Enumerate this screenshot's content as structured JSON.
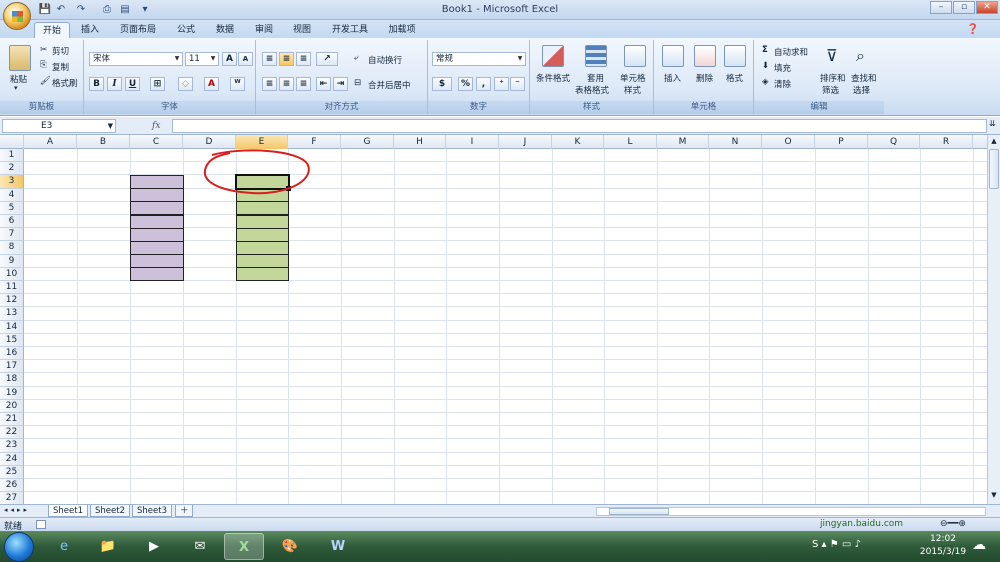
{
  "window": {
    "title": "Book1 - Microsoft Excel",
    "minimize": "–",
    "maximize": "▫",
    "close": "✕"
  },
  "qat": {
    "save": "💾",
    "undo": "↶",
    "redo": "↷",
    "print": "⎙",
    "more": "▾"
  },
  "tabs": [
    "开始",
    "插入",
    "页面布局",
    "公式",
    "数据",
    "审阅",
    "视图",
    "开发工具",
    "加载项"
  ],
  "ribbon": {
    "clipboard": {
      "label": "剪贴板",
      "paste": "粘贴",
      "cut": "剪切",
      "copy": "复制",
      "format_painter": "格式刷"
    },
    "font": {
      "label": "字体",
      "name": "宋体",
      "size": "11",
      "grow": "A",
      "shrink": "A",
      "bold": "B",
      "italic": "I",
      "underline": "U",
      "fill_glyph": "◇",
      "fontcolor_glyph": "A",
      "phonetic_glyph": "ᵂ"
    },
    "alignment": {
      "label": "对齐方式",
      "wrap": "自动换行",
      "merge": "合并后居中"
    },
    "number": {
      "label": "数字",
      "format": "常规",
      "percent": "%",
      "comma": ","
    },
    "styles": {
      "label": "样式",
      "conditional": "条件格式",
      "table_fmt_1": "套用",
      "table_fmt_2": "表格格式",
      "cell_style_1": "单元格",
      "cell_style_2": "样式"
    },
    "cells": {
      "label": "单元格",
      "insert": "插入",
      "delete": "删除",
      "format": "格式"
    },
    "editing": {
      "label": "编辑",
      "autosum": "自动求和",
      "fill": "填充",
      "clear": "清除",
      "sort_1": "排序和",
      "sort_2": "筛选",
      "find_1": "查找和",
      "find_2": "选择"
    }
  },
  "formula_bar": {
    "name_box": "E3",
    "fx": "fx",
    "value": ""
  },
  "columns": [
    "A",
    "B",
    "C",
    "D",
    "E",
    "F",
    "G",
    "H",
    "I",
    "J",
    "K",
    "L",
    "M",
    "N",
    "O",
    "P",
    "Q",
    "R"
  ],
  "rows": [
    "1",
    "2",
    "3",
    "4",
    "5",
    "6",
    "7",
    "8",
    "9",
    "10",
    "11",
    "12",
    "13",
    "14",
    "15",
    "16",
    "17",
    "18",
    "19",
    "20",
    "21",
    "22",
    "23",
    "24",
    "25",
    "26",
    "27"
  ],
  "selected_cell": "E3",
  "sheets": [
    "Sheet1",
    "Sheet2",
    "Sheet3"
  ],
  "status": {
    "ready": "就绪"
  },
  "colors": {
    "purple_fill": "#ccc0da",
    "green_fill": "#c4d79b",
    "annotation": "#d81f1f",
    "selection_header": "#f4c66b"
  },
  "clock": {
    "time": "12:02",
    "date": "2015/3/19"
  },
  "watermark": {
    "text": "jingyan.baidu.com"
  }
}
